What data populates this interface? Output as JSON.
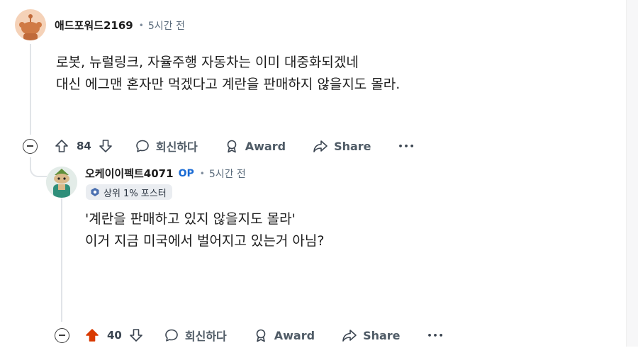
{
  "colors": {
    "accent_blue": "#1a6bd4",
    "upvote_active": "#d93a00",
    "thread_line": "#e1e4e8",
    "muted": "#5a6b7b"
  },
  "comment1": {
    "username": "애드포워드2169",
    "separator": "•",
    "time": "5시간 전",
    "avatar_icon": "snoo-avatar-orange",
    "body": [
      "로봇, 뉴럴링크, 자율주행 자동차는 이미 대중화되겠네",
      "대신 에그맨 혼자만 먹겠다고 계란을 판매하지 않을지도 몰라."
    ],
    "actions": {
      "score": "84",
      "reply": "회신하다",
      "award": "Award",
      "share": "Share",
      "more": "•••"
    }
  },
  "comment2": {
    "username": "오케이이펙트4071",
    "op_badge": "OP",
    "separator": "•",
    "time": "5시간 전",
    "avatar_icon": "snoo-avatar-green",
    "flair": "상위 1% 포스터",
    "body": [
      "'계란을 판매하고 있지 않을지도 몰라'",
      "이거 지금 미국에서 벌어지고 있는거 아님?"
    ],
    "actions": {
      "score": "40",
      "upvoted": true,
      "reply": "회신하다",
      "award": "Award",
      "share": "Share",
      "more": "•••"
    }
  }
}
